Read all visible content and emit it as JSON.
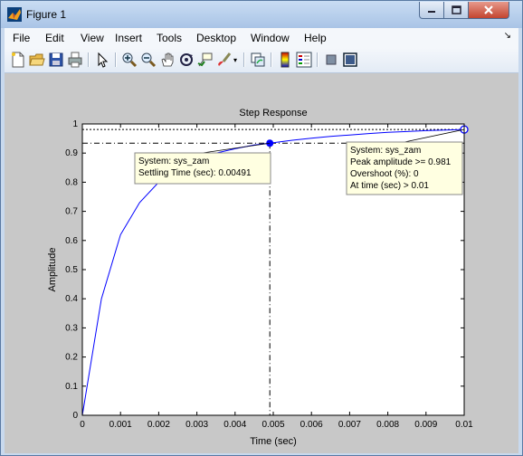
{
  "window": {
    "title": "Figure 1",
    "accent": "#c8d9ee"
  },
  "menubar": {
    "items": [
      "File",
      "Edit",
      "View",
      "Insert",
      "Tools",
      "Desktop",
      "Window",
      "Help"
    ],
    "overflow_icon": "chevron-icon"
  },
  "toolbar": {
    "icons": [
      "new-figure-icon",
      "open-file-icon",
      "save-icon",
      "print-icon",
      "edit-plot-icon",
      "zoom-in-icon",
      "zoom-out-icon",
      "pan-icon",
      "rotate-3d-icon",
      "data-cursor-icon",
      "brush-icon",
      "link-plot-icon",
      "colorbar-icon",
      "legend-icon",
      "hide-plot-tools-icon",
      "show-plot-tools-icon"
    ]
  },
  "chart_data": {
    "type": "line",
    "title": "Step Response",
    "xlabel": "Time (sec)",
    "ylabel": "Amplitude",
    "xlim": [
      0,
      0.01
    ],
    "ylim": [
      0,
      1
    ],
    "xticks": [
      "0",
      "0.001",
      "0.002",
      "0.003",
      "0.004",
      "0.005",
      "0.006",
      "0.007",
      "0.008",
      "0.009",
      "0.01"
    ],
    "yticks": [
      "0",
      "0.1",
      "0.2",
      "0.3",
      "0.4",
      "0.5",
      "0.6",
      "0.7",
      "0.8",
      "0.9",
      "1"
    ],
    "grid": false,
    "series": [
      {
        "color": "#0000ff",
        "x": [
          0,
          0.0005,
          0.001,
          0.0015,
          0.002,
          0.0025,
          0.003,
          0.0035,
          0.004,
          0.0045,
          0.00491,
          0.0055,
          0.006,
          0.0065,
          0.007,
          0.0075,
          0.008,
          0.0085,
          0.009,
          0.0095,
          0.01
        ],
        "y": [
          0,
          0.4,
          0.62,
          0.73,
          0.8,
          0.845,
          0.878,
          0.9,
          0.915,
          0.928,
          0.934,
          0.944,
          0.951,
          0.957,
          0.962,
          0.967,
          0.971,
          0.974,
          0.977,
          0.979,
          0.981
        ]
      }
    ],
    "reference_lines": {
      "final_value": 0.981,
      "settling_value": 0.934,
      "settling_time": 0.00491
    },
    "markers": [
      {
        "x": 0.00491,
        "y": 0.934,
        "style": "filled"
      },
      {
        "x": 0.01,
        "y": 0.981,
        "style": "open"
      }
    ],
    "datatips": [
      {
        "anchor_x": 0.00491,
        "anchor_y": 0.934,
        "lines": [
          "System: sys_zam",
          "Settling Time (sec): 0.00491"
        ]
      },
      {
        "anchor_x": 0.01,
        "anchor_y": 0.981,
        "lines": [
          "System: sys_zam",
          "Peak amplitude >= 0.981",
          "Overshoot (%): 0",
          "At time (sec) > 0.01"
        ]
      }
    ]
  }
}
